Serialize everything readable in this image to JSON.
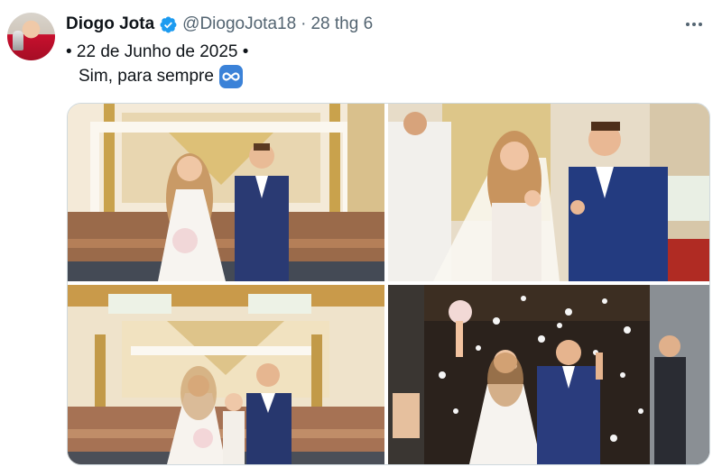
{
  "tweet": {
    "author_name": "Diogo Jota",
    "handle": "@DiogoJota18",
    "separator": "·",
    "date": "28 thg 6",
    "text_line1": "• 22 de Junho de 2025 •",
    "text_line2": "Sim, para sempre",
    "emoji": "infinity-emoji",
    "verified_color": "#1d9bf0"
  },
  "media": {
    "count": 4,
    "photos": [
      {
        "name": "photo-couple-at-altar"
      },
      {
        "name": "photo-couple-showing-rings"
      },
      {
        "name": "photo-family-at-altar"
      },
      {
        "name": "photo-confetti-exit"
      }
    ]
  },
  "icons": {
    "verified": "verified-badge-icon",
    "more": "more-options-icon"
  }
}
